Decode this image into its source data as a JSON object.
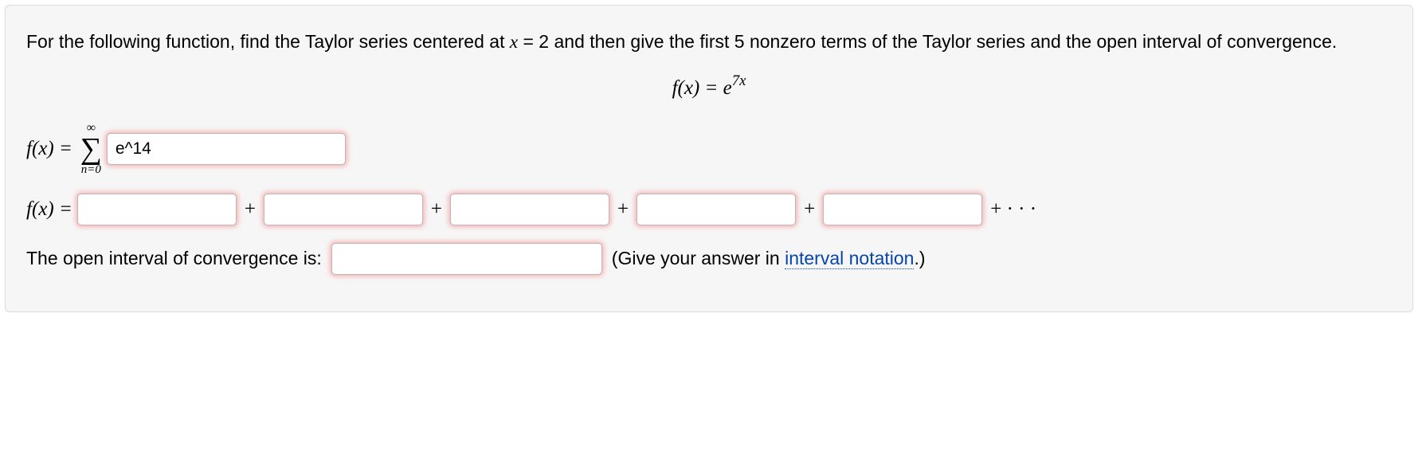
{
  "prompt": {
    "part1": "For the following function, find the Taylor series centered at ",
    "center_var": "x",
    "equals": " = ",
    "center_value": "2",
    "part2": " and then give the first 5 nonzero terms of the Taylor series and the open interval of convergence."
  },
  "function_display": {
    "lhs": "f(x) = e",
    "exponent": "7x"
  },
  "series_row": {
    "lhs": "f(x) = ",
    "sum_top": "∞",
    "sum_sigma": "∑",
    "sum_bottom": "n=0",
    "input_value": "e^14"
  },
  "terms_row": {
    "lhs": "f(x) = ",
    "plus": "+",
    "tail": "+ · · ·",
    "term1": "",
    "term2": "",
    "term3": "",
    "term4": "",
    "term5": ""
  },
  "interval_row": {
    "label": "The open interval of convergence is:",
    "input_value": "",
    "hint_prefix": "(Give your answer in ",
    "hint_link": "interval notation",
    "hint_suffix": ".)"
  }
}
